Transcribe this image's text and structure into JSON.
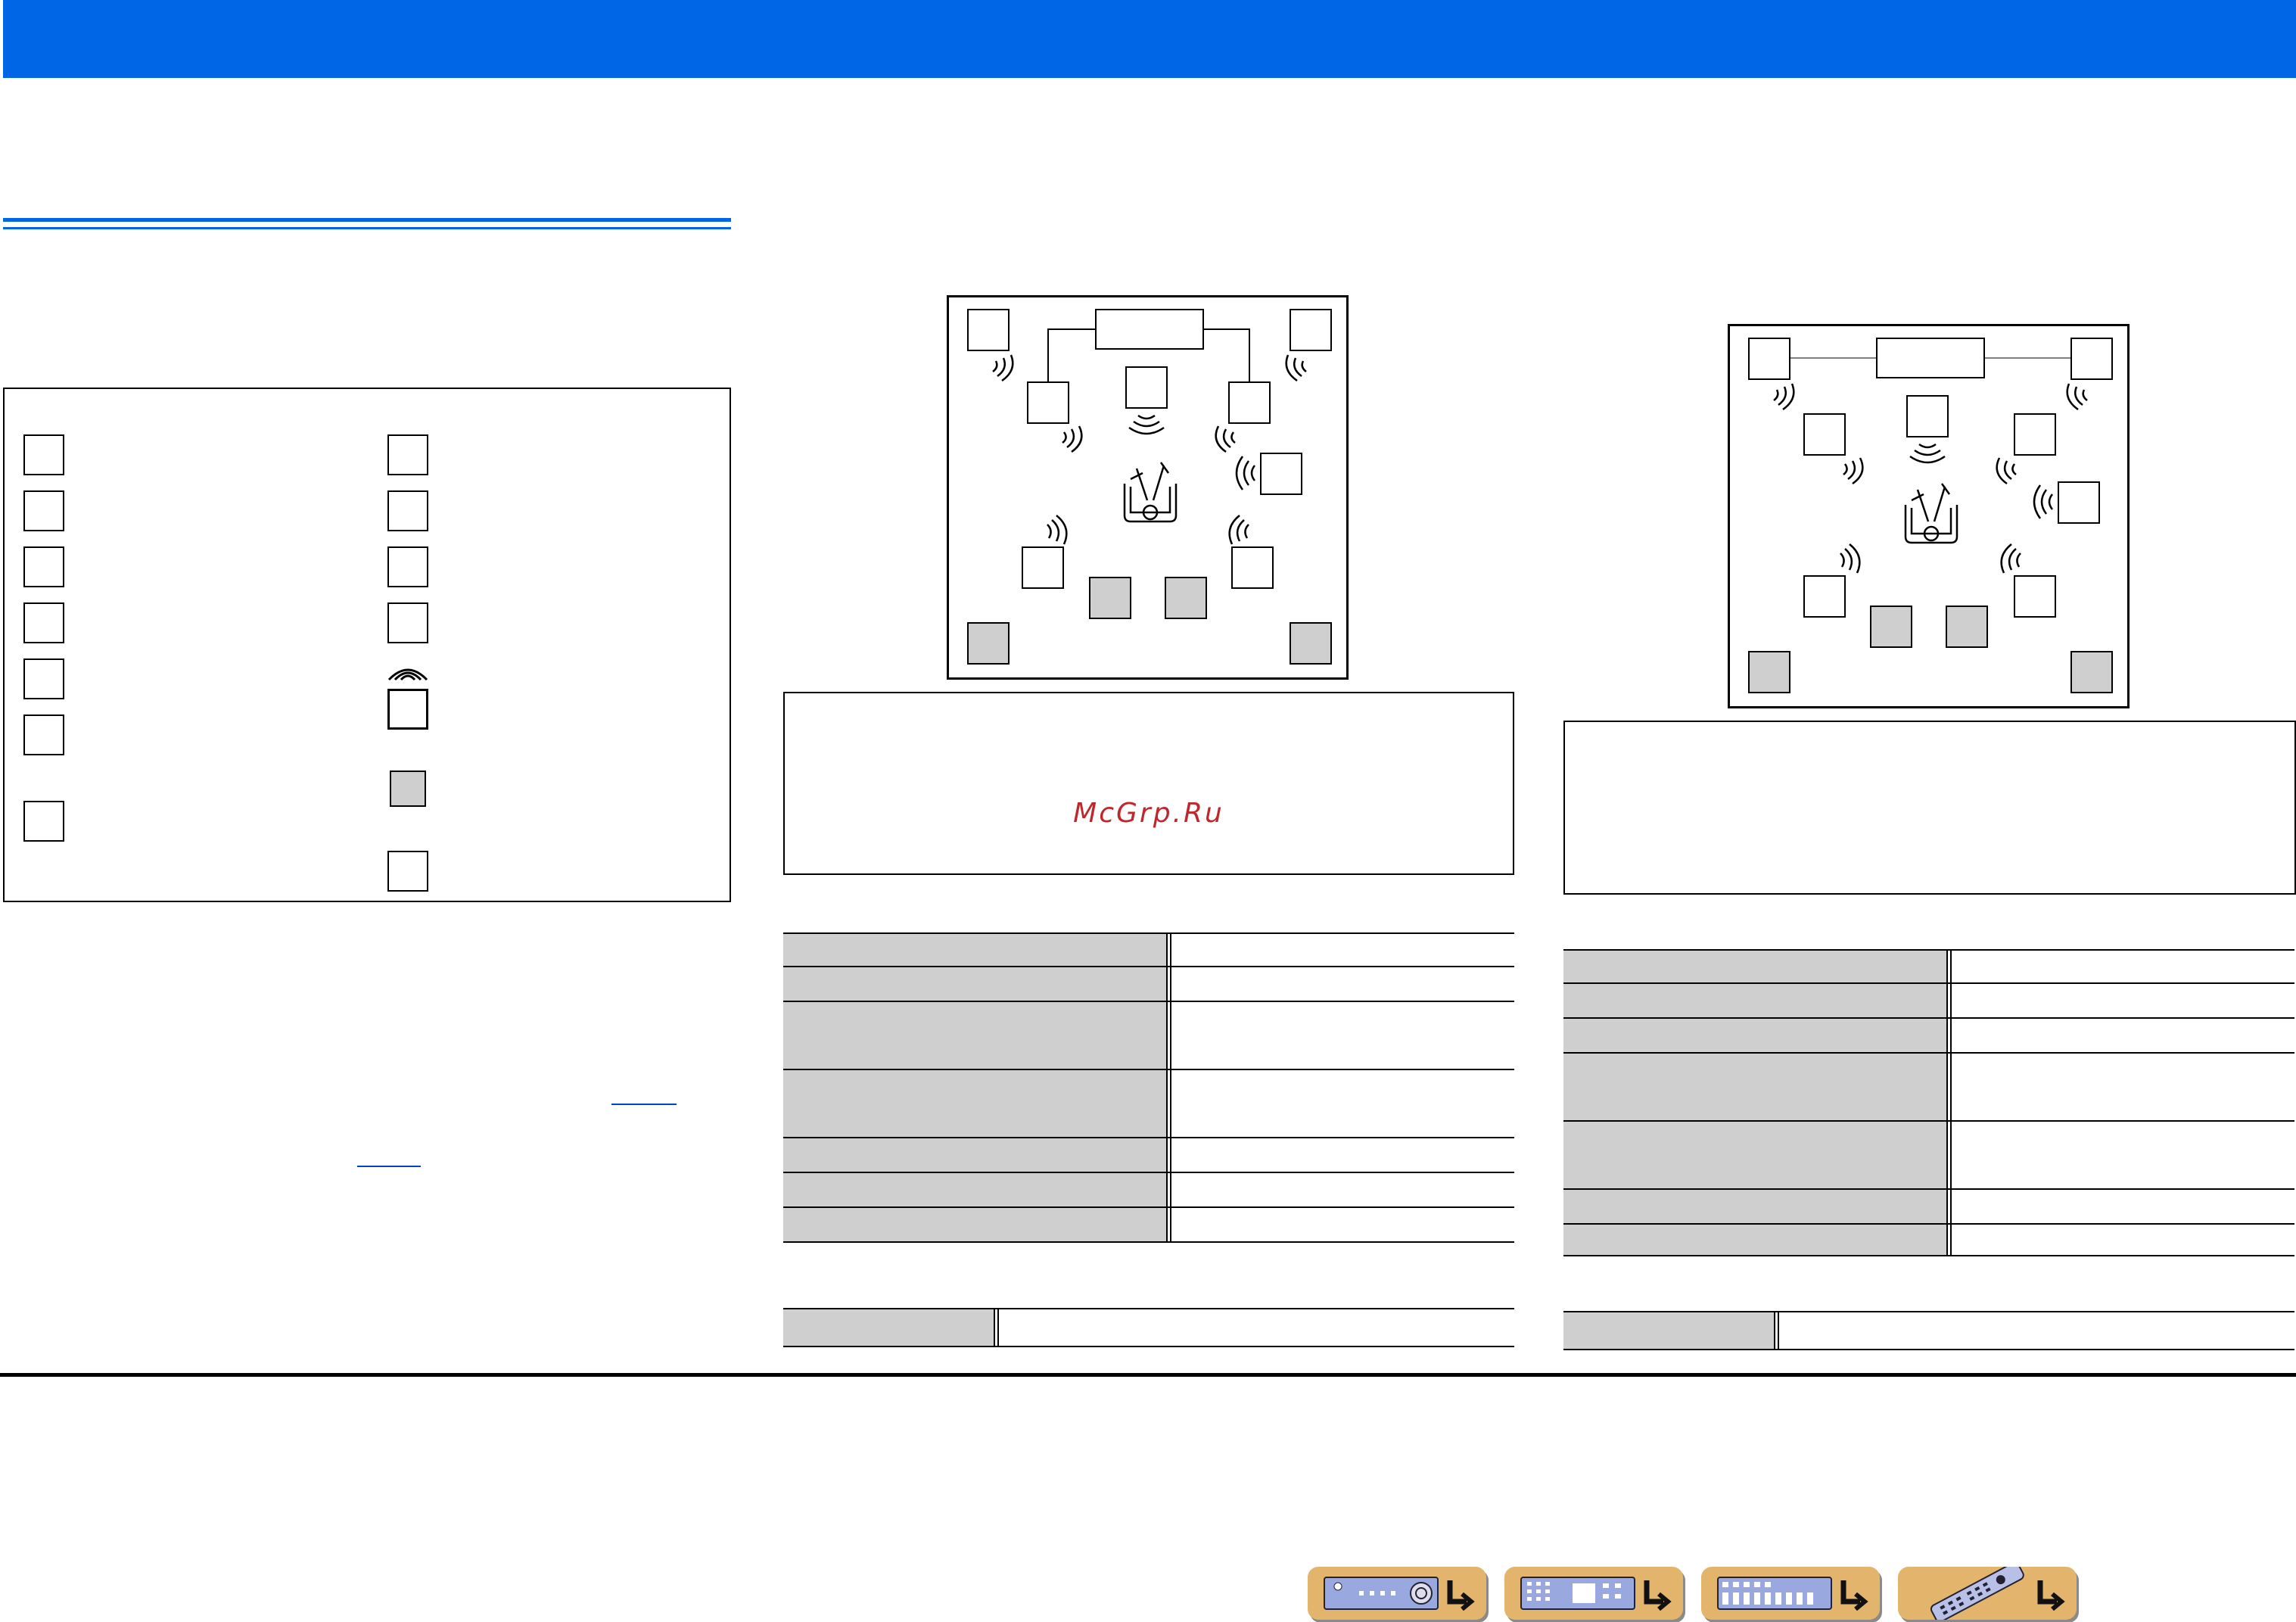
{
  "header": {
    "title": ""
  },
  "watermark": {
    "text": "McGrp.Ru"
  },
  "legend": {
    "title": ""
  },
  "nav": {
    "buttons": [
      {
        "icon": "receiver-front-panel-icon"
      },
      {
        "icon": "receiver-control-panel-icon"
      },
      {
        "icon": "receiver-rear-panel-icon"
      },
      {
        "icon": "remote-control-icon"
      }
    ]
  }
}
